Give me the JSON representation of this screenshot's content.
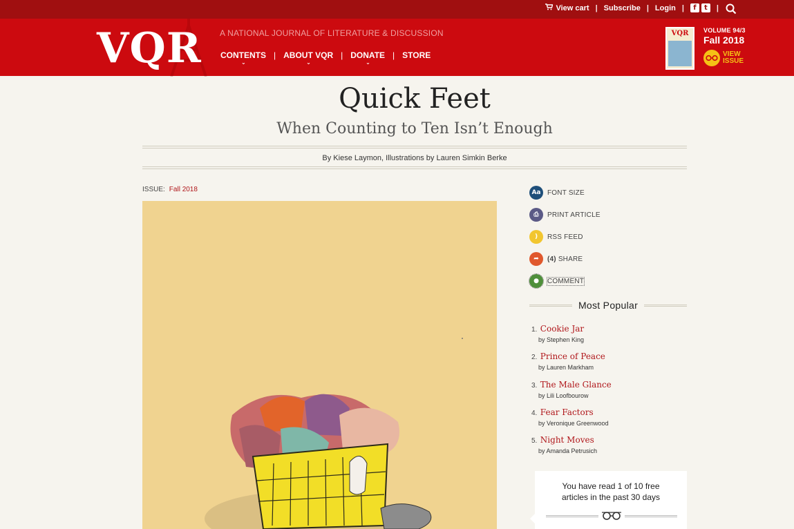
{
  "topbar": {
    "view_cart": "View cart",
    "subscribe": "Subscribe",
    "login": "Login",
    "sep": "|"
  },
  "header": {
    "logo": "VQR",
    "tagline": "A NATIONAL JOURNAL OF LITERATURE & DISCUSSION",
    "nav": [
      {
        "label": "CONTENTS"
      },
      {
        "label": "ABOUT VQR"
      },
      {
        "label": "DONATE"
      },
      {
        "label": "STORE"
      }
    ],
    "issue_cover_title": "VQR",
    "volume": "VOLUME 94/3",
    "season": "Fall 2018",
    "view_issue": "VIEW ISSUE"
  },
  "article": {
    "title": "Quick Feet",
    "subtitle": "When Counting to Ten Isn’t Enough",
    "byline": "By Kiese Laymon, Illustrations by Lauren Simkin Berke",
    "issue_label": "ISSUE:",
    "issue_value": "Fall 2018"
  },
  "tools": [
    {
      "label": "FONT SIZE",
      "glyph": "Aa",
      "color": "#1f4f7a"
    },
    {
      "label": "PRINT ARTICLE",
      "glyph": "⎙",
      "color": "#5b5a86"
    },
    {
      "label": "RSS FEED",
      "glyph": ")",
      "color": "#f2c62f"
    },
    {
      "count": "(4)",
      "label": "SHARE",
      "glyph": "➦",
      "color": "#e0582c"
    },
    {
      "label": "COMMENT",
      "glyph": "●",
      "color": "#4f8f3a"
    }
  ],
  "most_popular": {
    "heading": "Most  Popular",
    "items": [
      {
        "num": "1.",
        "title": "Cookie Jar",
        "by": "by Stephen King"
      },
      {
        "num": "2.",
        "title": "Prince of Peace",
        "by": "by Lauren Markham"
      },
      {
        "num": "3.",
        "title": "The Male Glance",
        "by": "by Lili Loofbourow"
      },
      {
        "num": "4.",
        "title": "Fear Factors",
        "by": "by Veronique Greenwood"
      },
      {
        "num": "5.",
        "title": "Night Moves",
        "by": "by Amanda Petrusich"
      }
    ]
  },
  "meter": {
    "line1": "You have read 1 of 10 free",
    "line2": "articles in the past 30 days"
  }
}
